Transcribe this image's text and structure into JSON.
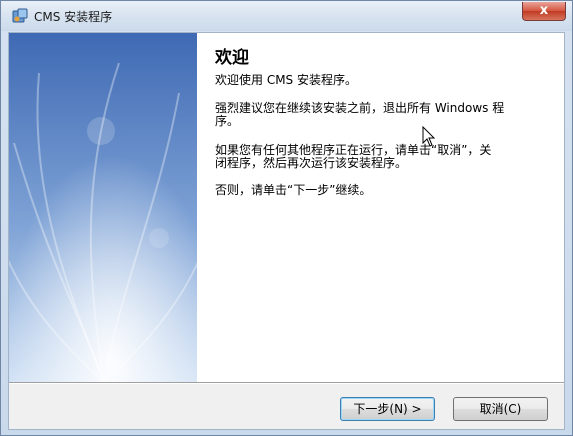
{
  "window": {
    "title": "CMS 安装程序",
    "close_label": "x"
  },
  "welcome": {
    "heading": "欢迎",
    "line1": "欢迎使用 CMS  安装程序。",
    "line2a": "强烈建议您在继续该安装之前，退出所有 Windows 程",
    "line2b": "序。",
    "line3a": "如果您有任何其他程序正在运行，请单击“取消”，关",
    "line3b": "闭程序，然后再次运行该安装程序。",
    "line4": "否则，请单击“下一步”继续。"
  },
  "buttons": {
    "next": "下一步(N) >",
    "cancel": "取消(C)"
  },
  "colors": {
    "titlebar": "#d6e2ef",
    "close_button": "#c03a23",
    "banner": "#5b7fc0"
  }
}
